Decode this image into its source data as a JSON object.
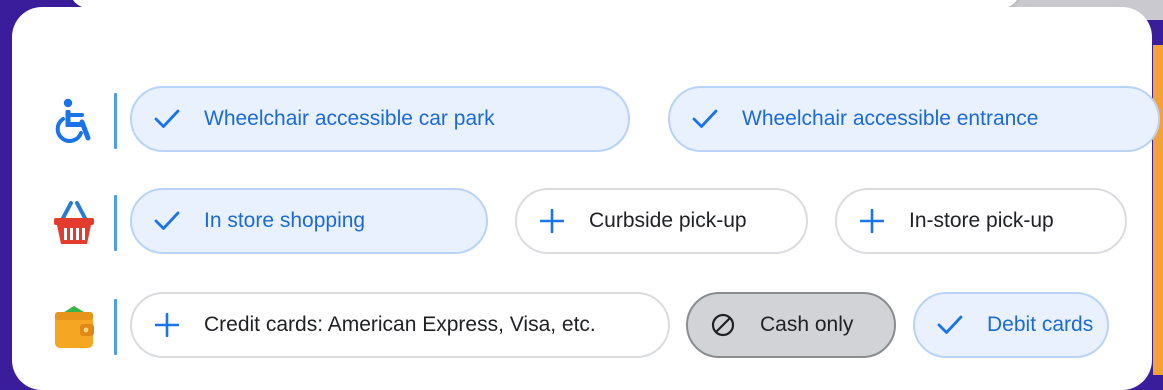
{
  "colors": {
    "accent_blue": "#1a73e8",
    "active_chip_bg": "#e9f1fe",
    "backdrop_purple": "#3a1d9a",
    "divider_blue": "#4ba1e6"
  },
  "rows": [
    {
      "icon": "wheelchair-icon",
      "chips": [
        {
          "label": "Wheelchair accessible car park",
          "state": "selected",
          "icon": "check-icon"
        },
        {
          "label": "Wheelchair accessible entrance",
          "state": "selected",
          "icon": "check-icon"
        }
      ]
    },
    {
      "icon": "shopping-basket-icon",
      "chips": [
        {
          "label": "In store shopping",
          "state": "selected",
          "icon": "check-icon"
        },
        {
          "label": "Curbside pick-up",
          "state": "unselected",
          "icon": "plus-icon"
        },
        {
          "label": "In-store pick-up",
          "state": "unselected",
          "icon": "plus-icon"
        }
      ]
    },
    {
      "icon": "wallet-icon",
      "chips": [
        {
          "label": "Credit cards: American Express, Visa, etc.",
          "state": "unselected",
          "icon": "plus-icon"
        },
        {
          "label": "Cash only",
          "state": "not-available",
          "icon": "prohibited-icon"
        },
        {
          "label": "Debit cards",
          "state": "selected",
          "icon": "check-icon"
        }
      ]
    }
  ]
}
